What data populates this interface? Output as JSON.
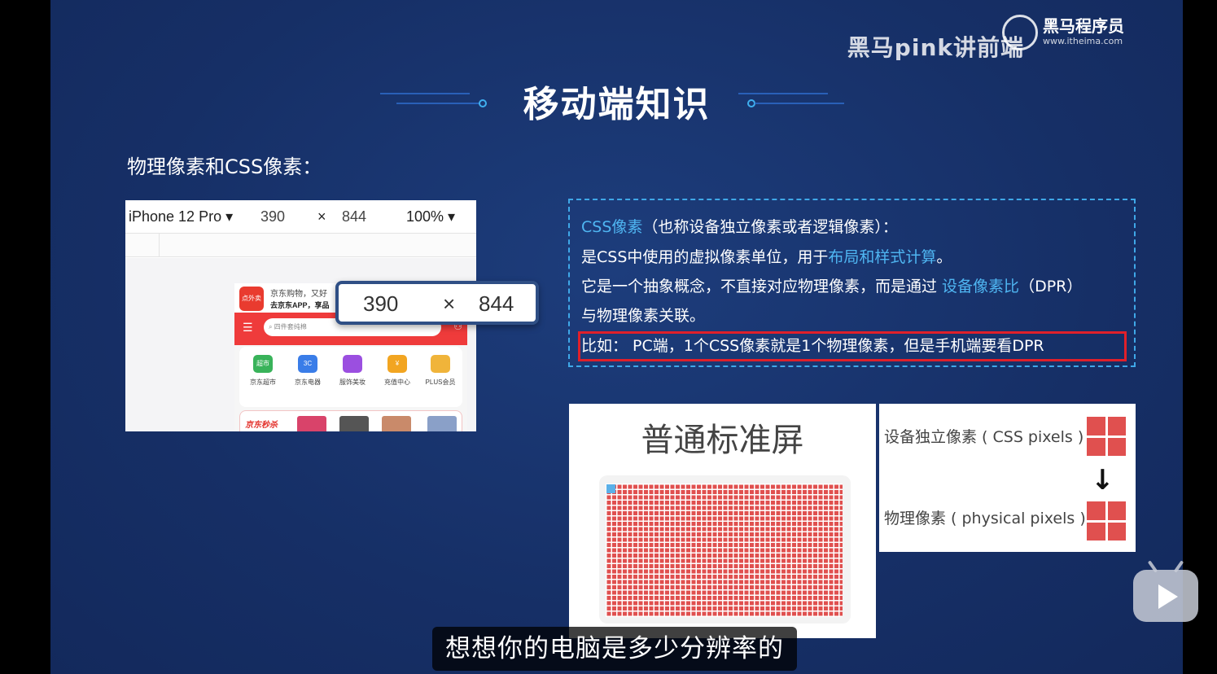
{
  "watermark": {
    "channel": "黑马pink讲前端",
    "brand": "黑马程序员",
    "url": "www.itheima.com",
    "platform": "bilibili"
  },
  "slide": {
    "title": "移动端知识",
    "subtitle": "物理像素和CSS像素："
  },
  "devtools": {
    "device": "iPhone 12 Pro",
    "width": "390",
    "times": "×",
    "height": "844",
    "zoom": "100%",
    "overlay_width": "390",
    "overlay_times": "×",
    "overlay_height": "844"
  },
  "phone": {
    "logo": "点外卖",
    "line1": "京东购物，又好",
    "line2": "去京东APP，享品",
    "search_placeholder": "四件套纯棉",
    "items": [
      {
        "icon": "超市",
        "label": "京东超市",
        "color": "#39b35a"
      },
      {
        "icon": "3C",
        "label": "京东电器",
        "color": "#3a7de8"
      },
      {
        "icon": "",
        "label": "服饰美妆",
        "color": "#9b4fe0"
      },
      {
        "icon": "¥",
        "label": "充值中心",
        "color": "#f2a521"
      },
      {
        "icon": "",
        "label": "PLUS会员",
        "color": "#f0b43a"
      }
    ],
    "seckill": "京东秒杀"
  },
  "info": {
    "l1_blue": "CSS像素",
    "l1_rest": "（也称设备独立像素或者逻辑像素）：",
    "l2_a": "是CSS中使用的虚拟像素单位，用于",
    "l2_blue": "布局和样式计算",
    "l2_b": "。",
    "l3_a": "它是一个抽象概念，不直接对应物理像素，而是通过 ",
    "l3_blue": "设备像素比",
    "l3_b": "（DPR）",
    "l4": "与物理像素关联。",
    "l5": "比如： PC端，1个CSS像素就是1个物理像素，但是手机端要看DPR"
  },
  "figure_std": {
    "label": "普通标准屏"
  },
  "figure_legend": {
    "css_label": "设备独立像素 ( CSS pixels )",
    "arrow": "↓",
    "physical_label": "物理像素 ( physical pixels )"
  },
  "caption": {
    "text": "想想你的电脑是多少分辨率的"
  },
  "colors": {
    "slide_bg": "#17326b",
    "accent_blue": "#4fb6f2",
    "highlight_red": "#e0202a",
    "pixel_red": "#e0504f"
  }
}
